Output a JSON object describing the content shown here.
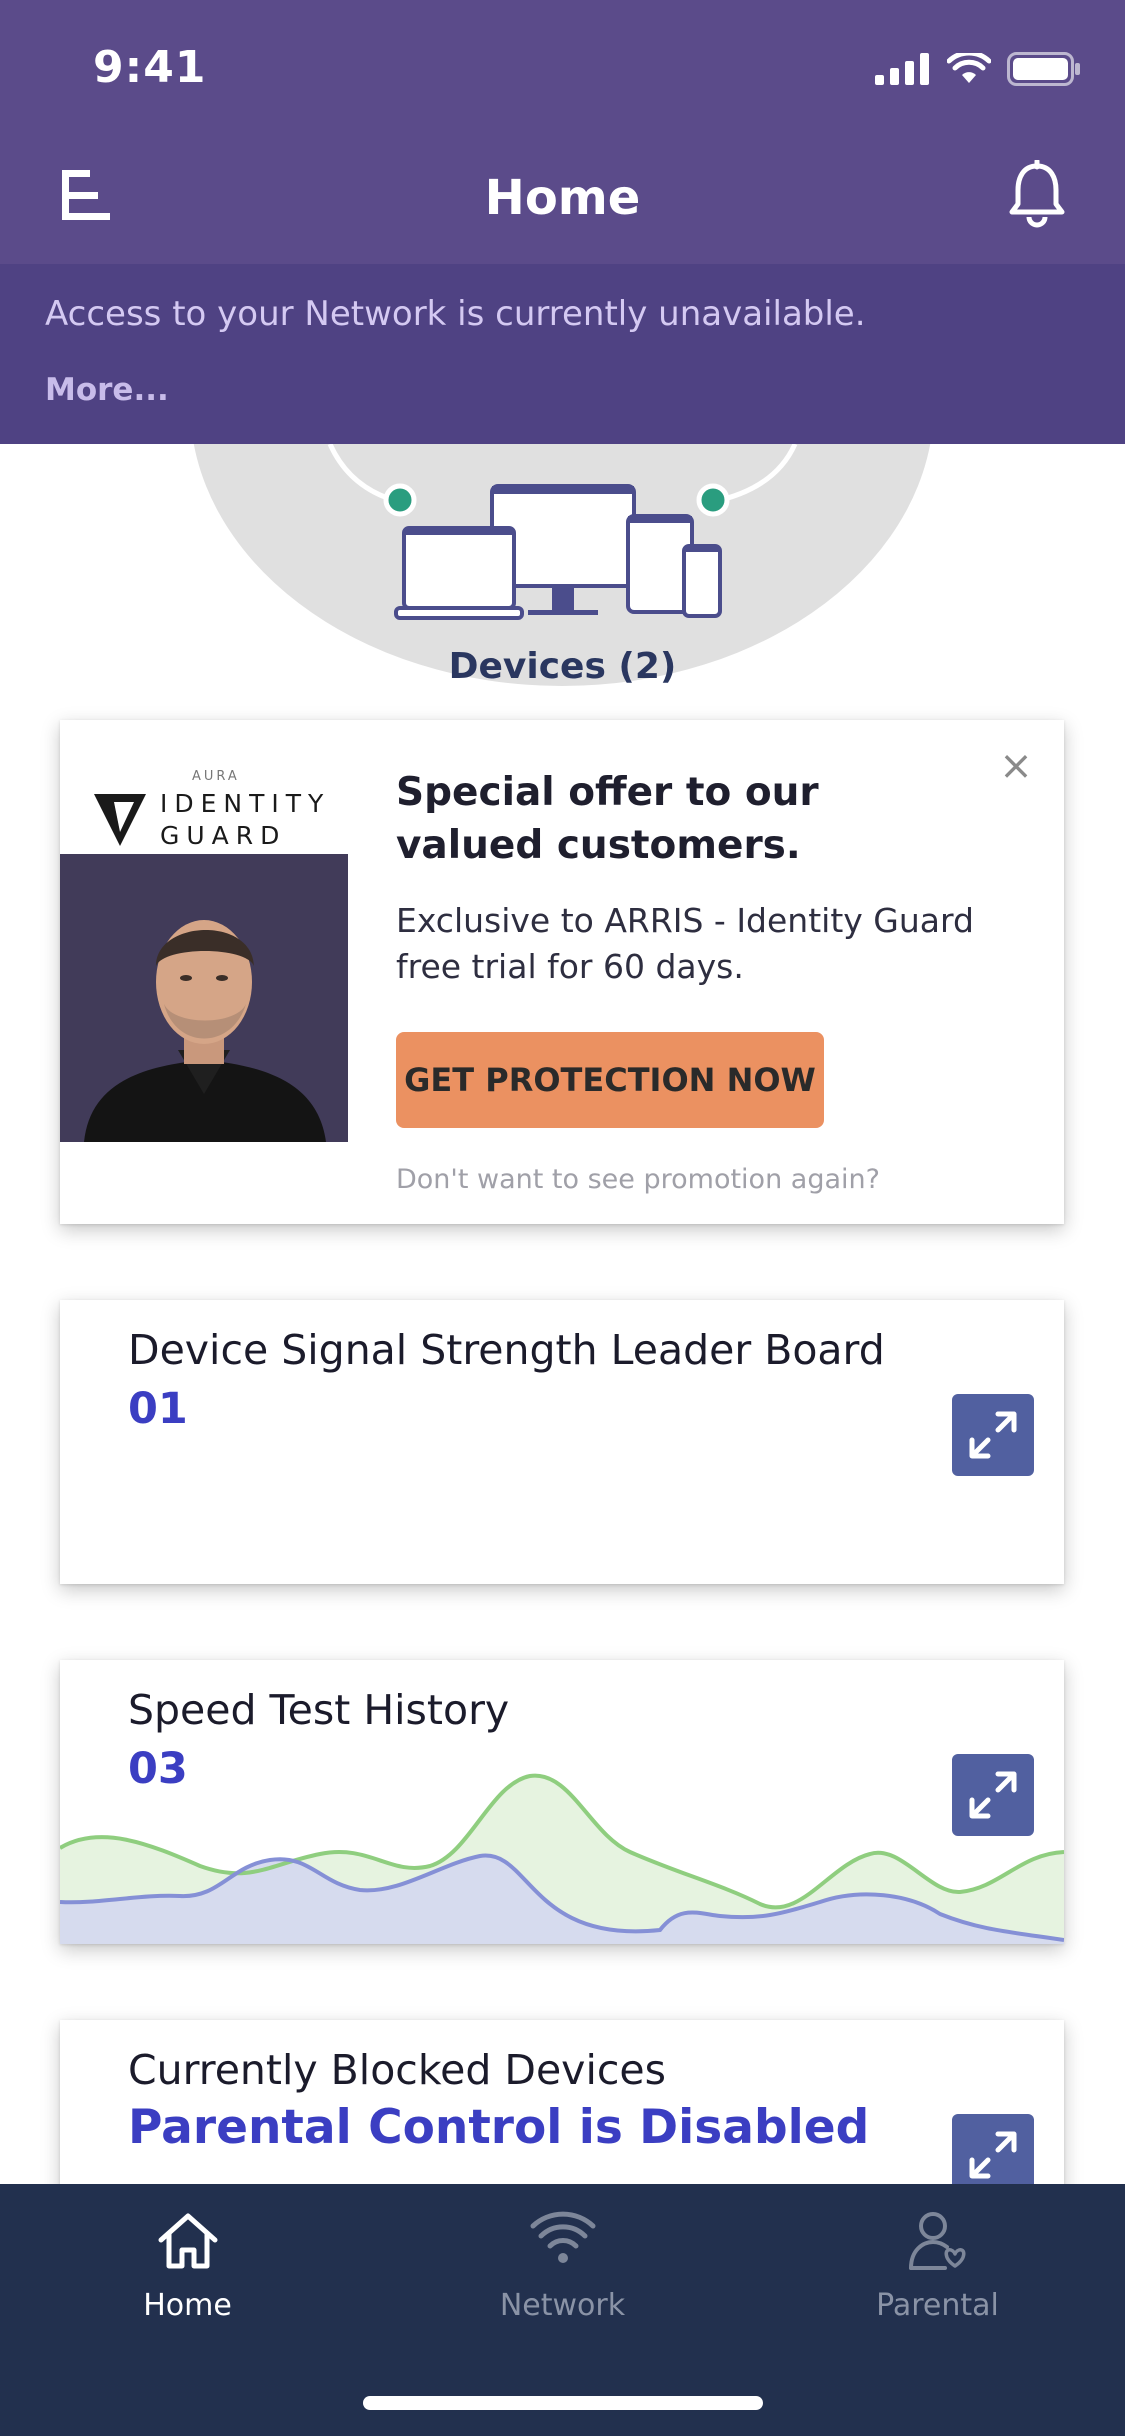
{
  "status_bar": {
    "time": "9:41"
  },
  "header": {
    "title": "Home"
  },
  "banner": {
    "message": "Access to your Network is currently unavailable.",
    "more_link": "More..."
  },
  "hero": {
    "devices_label": "Devices (2)"
  },
  "promo": {
    "logo_top": "AURA",
    "logo_line1": "IDENTITY",
    "logo_line2": "GUARD",
    "title_line1": "Special offer to our",
    "title_line2": "valued customers.",
    "description": "Exclusive to ARRIS - Identity Guard free trial for 60 days.",
    "cta_label": "GET PROTECTION NOW",
    "dismiss_text": "Don't want to see promotion again?",
    "close_glyph": "×"
  },
  "widgets": {
    "leaderboard": {
      "title": "Device Signal Strength Leader Board",
      "value": "01"
    },
    "speed_test": {
      "title": "Speed Test History",
      "value": "03"
    },
    "blocked": {
      "title": "Currently Blocked Devices",
      "value": "Parental Control is Disabled"
    }
  },
  "tabbar": {
    "tabs": [
      {
        "label": "Home",
        "icon": "home-icon",
        "active": true
      },
      {
        "label": "Network",
        "icon": "wifi-icon",
        "active": false
      },
      {
        "label": "Parental",
        "icon": "parental-icon",
        "active": false
      }
    ]
  },
  "colors": {
    "header": "#5b4b8a",
    "banner": "#4f4283",
    "accent_value": "#3b3ec2",
    "cta": "#eb9161",
    "expand_button": "#5160a0",
    "tabbar": "#22304e",
    "chart_green": "#8fce7f",
    "chart_blue": "#8590d6"
  }
}
